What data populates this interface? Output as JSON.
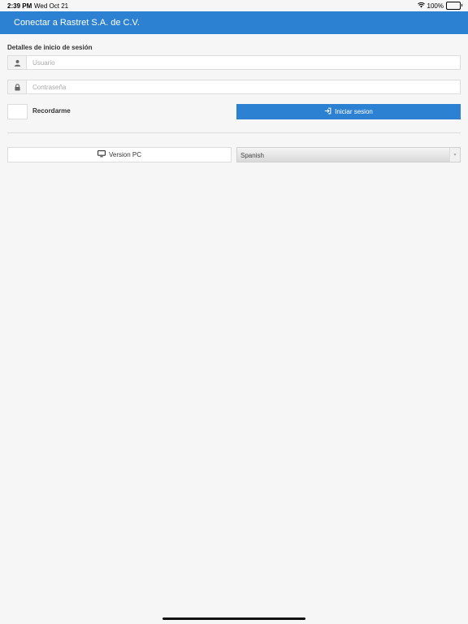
{
  "status_bar": {
    "time": "2:39 PM",
    "date": "Wed Oct 21",
    "battery": "100%",
    "wifi_icon": "wifi-icon",
    "battery_icon": "battery-icon"
  },
  "header": {
    "title": "Conectar a Rastret S.A. de C.V."
  },
  "login": {
    "section_label": "Detalles de inicio de sesión",
    "username": {
      "placeholder": "Usuario",
      "value": "",
      "icon": "user-icon"
    },
    "password": {
      "placeholder": "Contraseña",
      "value": "",
      "icon": "lock-icon"
    },
    "remember_label": "Recordarme",
    "submit_label": "Iniciar sesion",
    "submit_icon": "sign-in-icon"
  },
  "footer": {
    "pc_version_label": "Version PC",
    "pc_icon": "monitor-icon",
    "language_selected": "Spanish"
  },
  "colors": {
    "accent": "#2d81d3",
    "background": "#f6f6f6"
  }
}
